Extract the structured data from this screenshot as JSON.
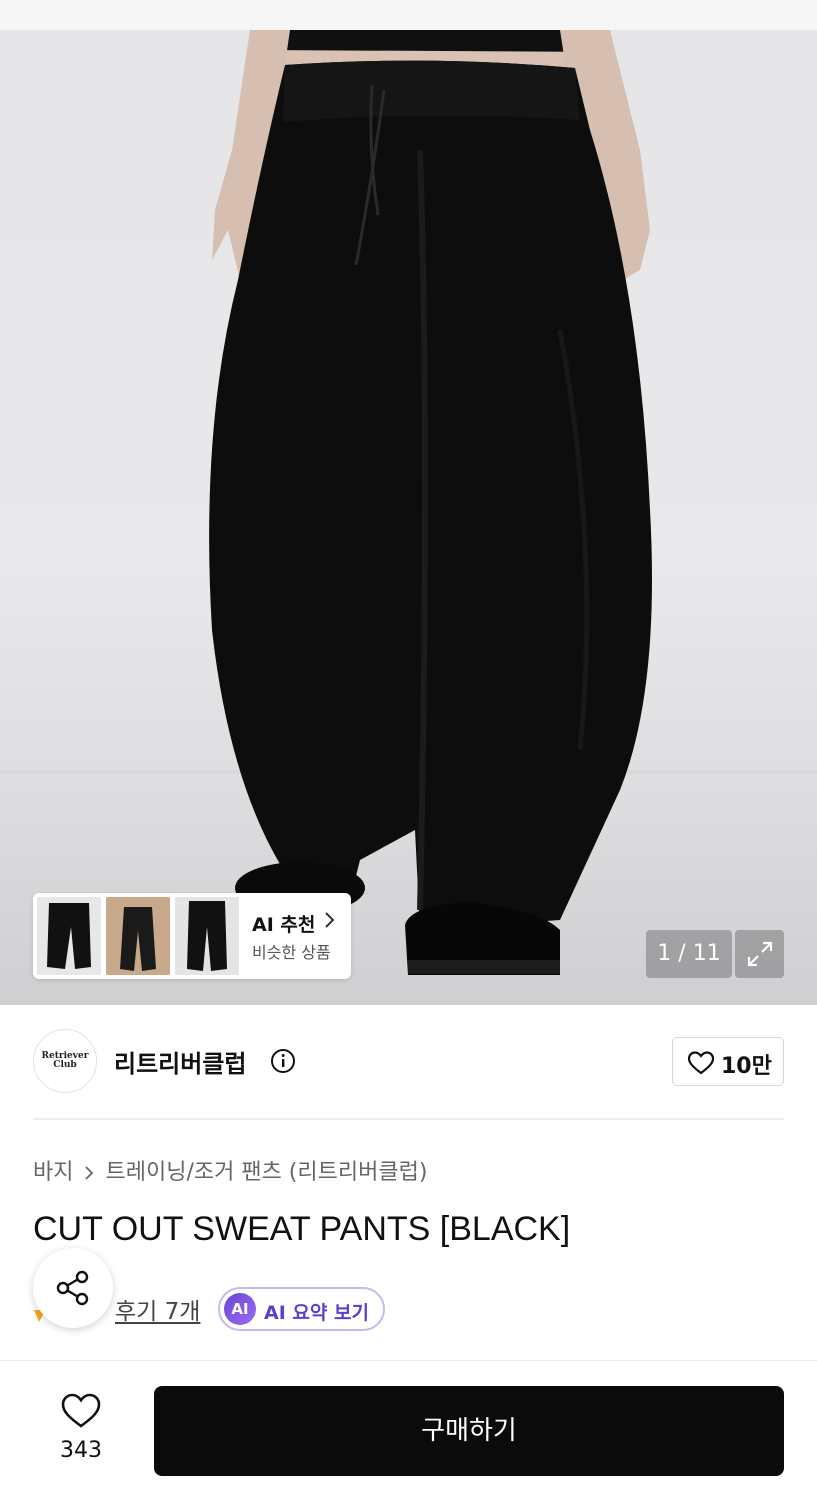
{
  "gallery": {
    "current_page": 1,
    "total_pages": 11,
    "counter_text": "1 / 11",
    "expand_icon": "expand-icon",
    "ai_recommend": {
      "title": "AI 추천",
      "subtitle": "비슷한 상품",
      "thumbnails": [
        "thumbnail-1",
        "thumbnail-2",
        "thumbnail-3"
      ]
    }
  },
  "brand": {
    "logo_text_line1": "Retriever",
    "logo_text_line2": "Club",
    "name": "리트리버클럽",
    "info_icon": "info-icon",
    "likes": "10만",
    "like_icon": "heart-outline-icon"
  },
  "breadcrumb": {
    "category": "바지",
    "subcategory": "트레이닝/조거 팬츠 (리트리버클럽)"
  },
  "product": {
    "title": "CUT OUT SWEAT PANTS [BLACK]"
  },
  "reviews": {
    "link_text": "후기 7개",
    "ai_summary_badge": "AI",
    "ai_summary_label": "AI 요약 보기"
  },
  "bottom_bar": {
    "wish_count": "343",
    "buy_label": "구매하기"
  },
  "colors": {
    "buy_button": "#0b0b0b",
    "ai_accent": "#5b3fd0",
    "star": "#f5a623"
  }
}
